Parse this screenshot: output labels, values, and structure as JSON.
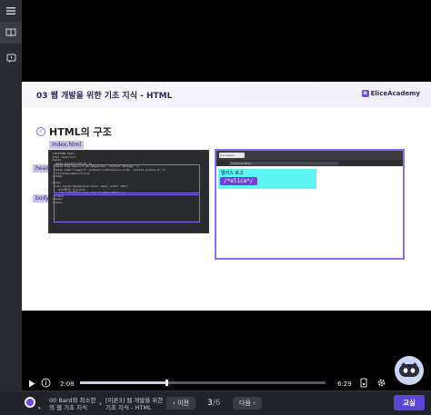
{
  "slide": {
    "title": "03 웹 개발을 위한 기초 지식 - HTML",
    "brand": "EliceAcademy",
    "subtitle": "HTML의 구조",
    "labels": {
      "file": "index.html",
      "head": "head",
      "body": "body"
    },
    "code_lines": [
      "<!DOCTYPE html>",
      "<html lang=\"ko\">",
      "<head>",
      "  <meta charset=\"utf-8\" />",
      "  <meta http-equiv=\"X-UA-Compatible\" content=\"IE=edge\" />",
      "  <meta name=\"viewport\" content=\"width=device-width, initial-scale=1.0\" />",
      "  <title>Document</title>",
      "</head>",
      "",
      "<body>",
      "  <div style=\"background-color: aqua; width: 50%\">",
      "    <h3>엘리스 로고</h3>",
      "    <img src=\"elice.png\" style=\"width: 200px\" />",
      "  </div>",
      "</body>",
      "</html>"
    ],
    "browser": {
      "tab": "Document",
      "url": "localhost:5501",
      "heading": "엘리스 로고",
      "logo_text": "/*elice*/"
    }
  },
  "player": {
    "current_time": "2:08",
    "total_time": "6:29",
    "progress": 0.35
  },
  "bottom": {
    "course": "00 Bard와 최소한의 웹 기초 지식",
    "lesson": "[이론3] 웹 개발을 위한 기초 지식 - HTML",
    "prev": "이전",
    "page_current": "3",
    "page_total": "/6",
    "next": "다음",
    "primary": "교실"
  },
  "colors": {
    "accent": "#5b45d6",
    "highlight": "#8b6ef2",
    "cyan": "#5ff5f5"
  }
}
